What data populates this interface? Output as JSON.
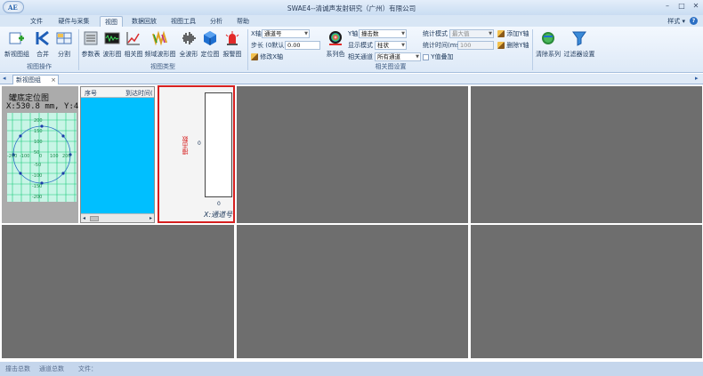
{
  "window": {
    "title": "SWAE4--清诚声发射研究（广州）有限公司",
    "logo_text": "AE"
  },
  "menu_tabs": [
    "文件",
    "硬件与采集",
    "视图",
    "数据回放",
    "视图工具",
    "分析",
    "帮助"
  ],
  "active_tab": "视图",
  "style_menu": "样式 ▾",
  "ribbon": {
    "view_ops": {
      "label": "视图操作",
      "buttons": [
        "新视图组",
        "合并",
        "分割"
      ]
    },
    "view_types": {
      "label": "视图类型",
      "buttons": [
        "参数表",
        "波形图",
        "相关图",
        "频域波形图",
        "全波形",
        "定位图",
        "报警图"
      ]
    },
    "plot_settings": {
      "label": "相关图设置",
      "x_axis_label": "X轴",
      "x_axis_value": "通道号",
      "step_label": "步长 (0默认)",
      "step_value": "0.00",
      "modify_x": "修改X轴",
      "series_color": "系列色",
      "y_axis_label": "Y轴",
      "y_axis_value": "撞击数",
      "display_mode_label": "显示模式",
      "display_mode_value": "柱状",
      "rel_channel_label": "相关通道",
      "rel_channel_value": "所有通道",
      "stat_mode_label": "统计模式",
      "stat_mode_value": "最大值",
      "stat_time_label": "统计时间(ms)",
      "stat_time_value": "100",
      "y_overlay": "Y值叠加",
      "add_y": "添加Y轴",
      "delete_y": "删除Y轴"
    },
    "extras": [
      "清除系列",
      "过滤器设置"
    ]
  },
  "doc_tab": {
    "label": "新视图组",
    "close": "×"
  },
  "panels": {
    "location": {
      "title": "罐底定位图",
      "coord": "X:530.8 mm, Y:4",
      "axis_ticks": [
        "200",
        "150",
        "100",
        "50",
        "0",
        "-50",
        "-100",
        "-150",
        "-200"
      ],
      "x_ticks": [
        "-200",
        "-100",
        "100",
        "200"
      ]
    },
    "param_table": {
      "columns": [
        "序号",
        "到达时间("
      ]
    },
    "correlation": {
      "y_label": "撞击数",
      "y_tick": "0",
      "x_tick": "0",
      "x_label": "X:通道号"
    }
  },
  "statusbar": {
    "hits": "撞击总数",
    "channels": "通道总数",
    "file": "文件："
  },
  "colors": {
    "accent": "#2b6fc4",
    "cell_bg": "#6e6e6e",
    "table_blue": "#00bfff",
    "grid_green": "#19c97a",
    "red_border": "#d62020"
  }
}
